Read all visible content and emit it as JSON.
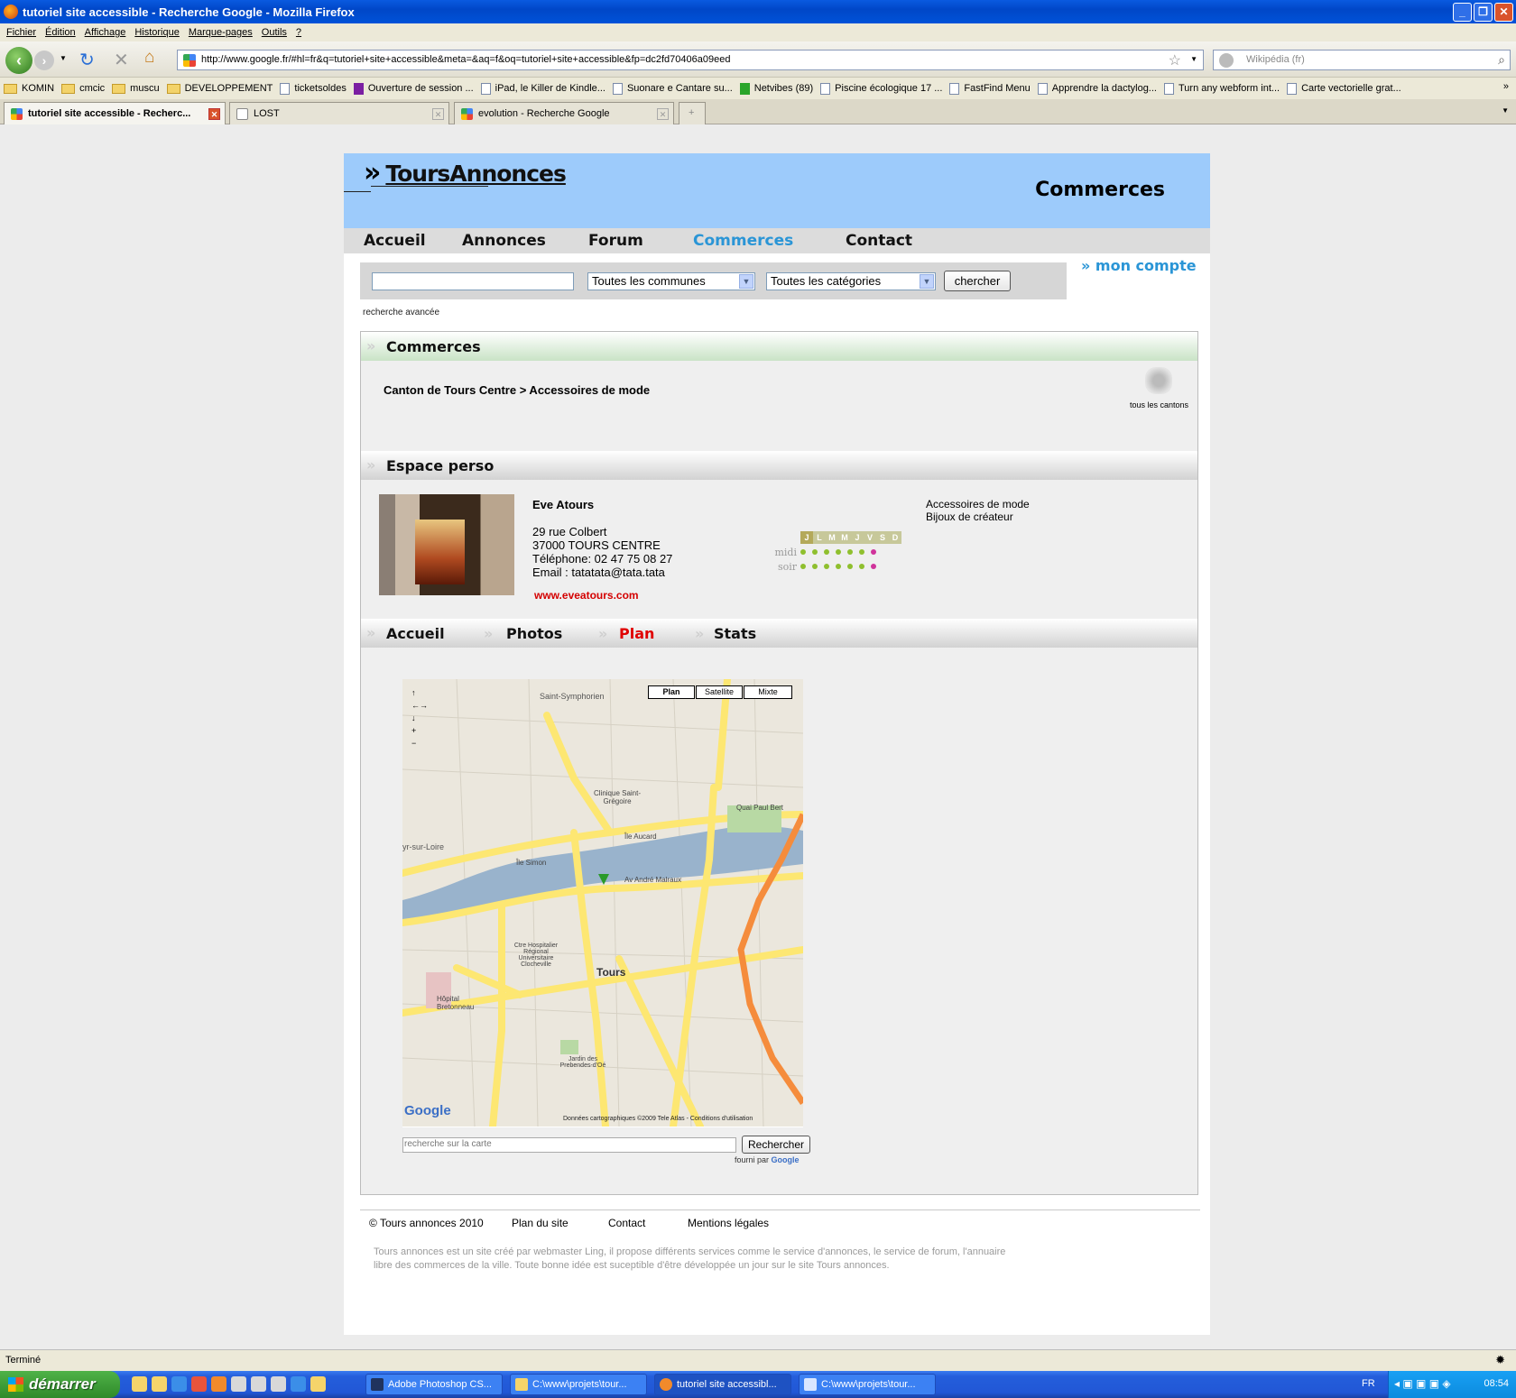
{
  "browser": {
    "window_title": "tutoriel site accessible - Recherche Google - Mozilla Firefox",
    "menu": [
      "Fichier",
      "Édition",
      "Affichage",
      "Historique",
      "Marque-pages",
      "Outils",
      "?"
    ],
    "url": "http://www.google.fr/#hl=fr&q=tutoriel+site+accessible&meta=&aq=f&oq=tutoriel+site+accessible&fp=dc2fd70406a09eed",
    "search_placeholder": "Wikipédia (fr)",
    "bookmarks": [
      "KOMIN",
      "cmcic",
      "muscu",
      "DEVELOPPEMENT",
      "ticketsoldes",
      "Ouverture de session ...",
      "iPad, le Killer de Kindle...",
      "Suonare e Cantare su...",
      "Netvibes (89)",
      "Piscine écologique 17 ...",
      "FastFind Menu",
      "Apprendre la dactylog...",
      "Turn any webform int...",
      "Carte vectorielle grat..."
    ],
    "tabs": [
      "tutoriel site accessible - Recherc...",
      "LOST",
      "evolution - Recherche Google"
    ],
    "status": "Terminé"
  },
  "site": {
    "logo": "ToursAnnonces",
    "banner_title": "Commerces",
    "nav": [
      "Accueil",
      "Annonces",
      "Forum",
      "Commerces",
      "Contact"
    ],
    "search": {
      "commune": "Toutes les communes",
      "categorie": "Toutes les catégories",
      "button": "chercher",
      "advanced": "recherche avancée"
    },
    "mon_compte": "mon compte",
    "commerces_heading": "Commerces",
    "breadcrumb": "Canton de Tours Centre > Accessoires de mode",
    "tous_cantons": "tous les cantons",
    "espace_heading": "Espace perso",
    "shop": {
      "name": "Eve Atours",
      "street": "29 rue Colbert",
      "city": "37000 TOURS CENTRE",
      "phone": "Téléphone: 02 47 75 08 27",
      "email": "Email : tatatata@tata.tata",
      "url": "www.eveatours.com",
      "categories": [
        "Accessoires de mode",
        "Bijoux de créateur"
      ]
    },
    "hours": {
      "days": [
        "J",
        "L",
        "M",
        "M",
        "J",
        "V",
        "S",
        "D"
      ],
      "midi_label": "midi",
      "soir_label": "soir"
    },
    "shop_tabs": [
      "Accueil",
      "Photos",
      "Plan",
      "Stats"
    ],
    "active_tab_color": "#e00000",
    "map": {
      "types": [
        "Plan",
        "Satellite",
        "Mixte"
      ],
      "label_city": "Tours",
      "label_n": "Saint-Symphorien",
      "label_w": "yr-sur-Loire",
      "label_river_n": "Quai Paul Bert",
      "label_river_s": "Av André Malraux",
      "label_clinic": "Clinique Saint-Grégoire",
      "label_hospital": "Hôpital Bretonneau",
      "label_chu": "Ctre Hospitalier Régional Universitaire Clocheville",
      "label_jardin": "Jardin des Prebendes-d'Oé",
      "label_ile": "Île Simon",
      "label_aucard": "Île Aucard",
      "google": "Google",
      "copyright": "Données cartographiques ©2009 Tele Atlas - Conditions d'utilisation",
      "query_placeholder": "recherche sur la carte",
      "button": "Rechercher",
      "provided_by": "fourni par",
      "provided_brand": "Google"
    },
    "footer": {
      "copyright": "© Tours annonces 2010",
      "links": [
        "Plan du site",
        "Contact",
        "Mentions légales"
      ],
      "description": "Tours annonces est un site créé par webmaster Ling, il propose différents services comme le service d'annonces, le service de forum, l'annuaire libre des commerces de la ville. Toute bonne idée est suceptible d'être développée un jour sur le site Tours annonces."
    },
    "accent_color": "#2a95d6"
  },
  "taskbar": {
    "start": "démarrer",
    "tasks": [
      "Adobe Photoshop CS...",
      "C:\\www\\projets\\tour...",
      "tutoriel site accessibl...",
      "C:\\www\\projets\\tour..."
    ],
    "lang": "FR",
    "clock": "08:54"
  }
}
